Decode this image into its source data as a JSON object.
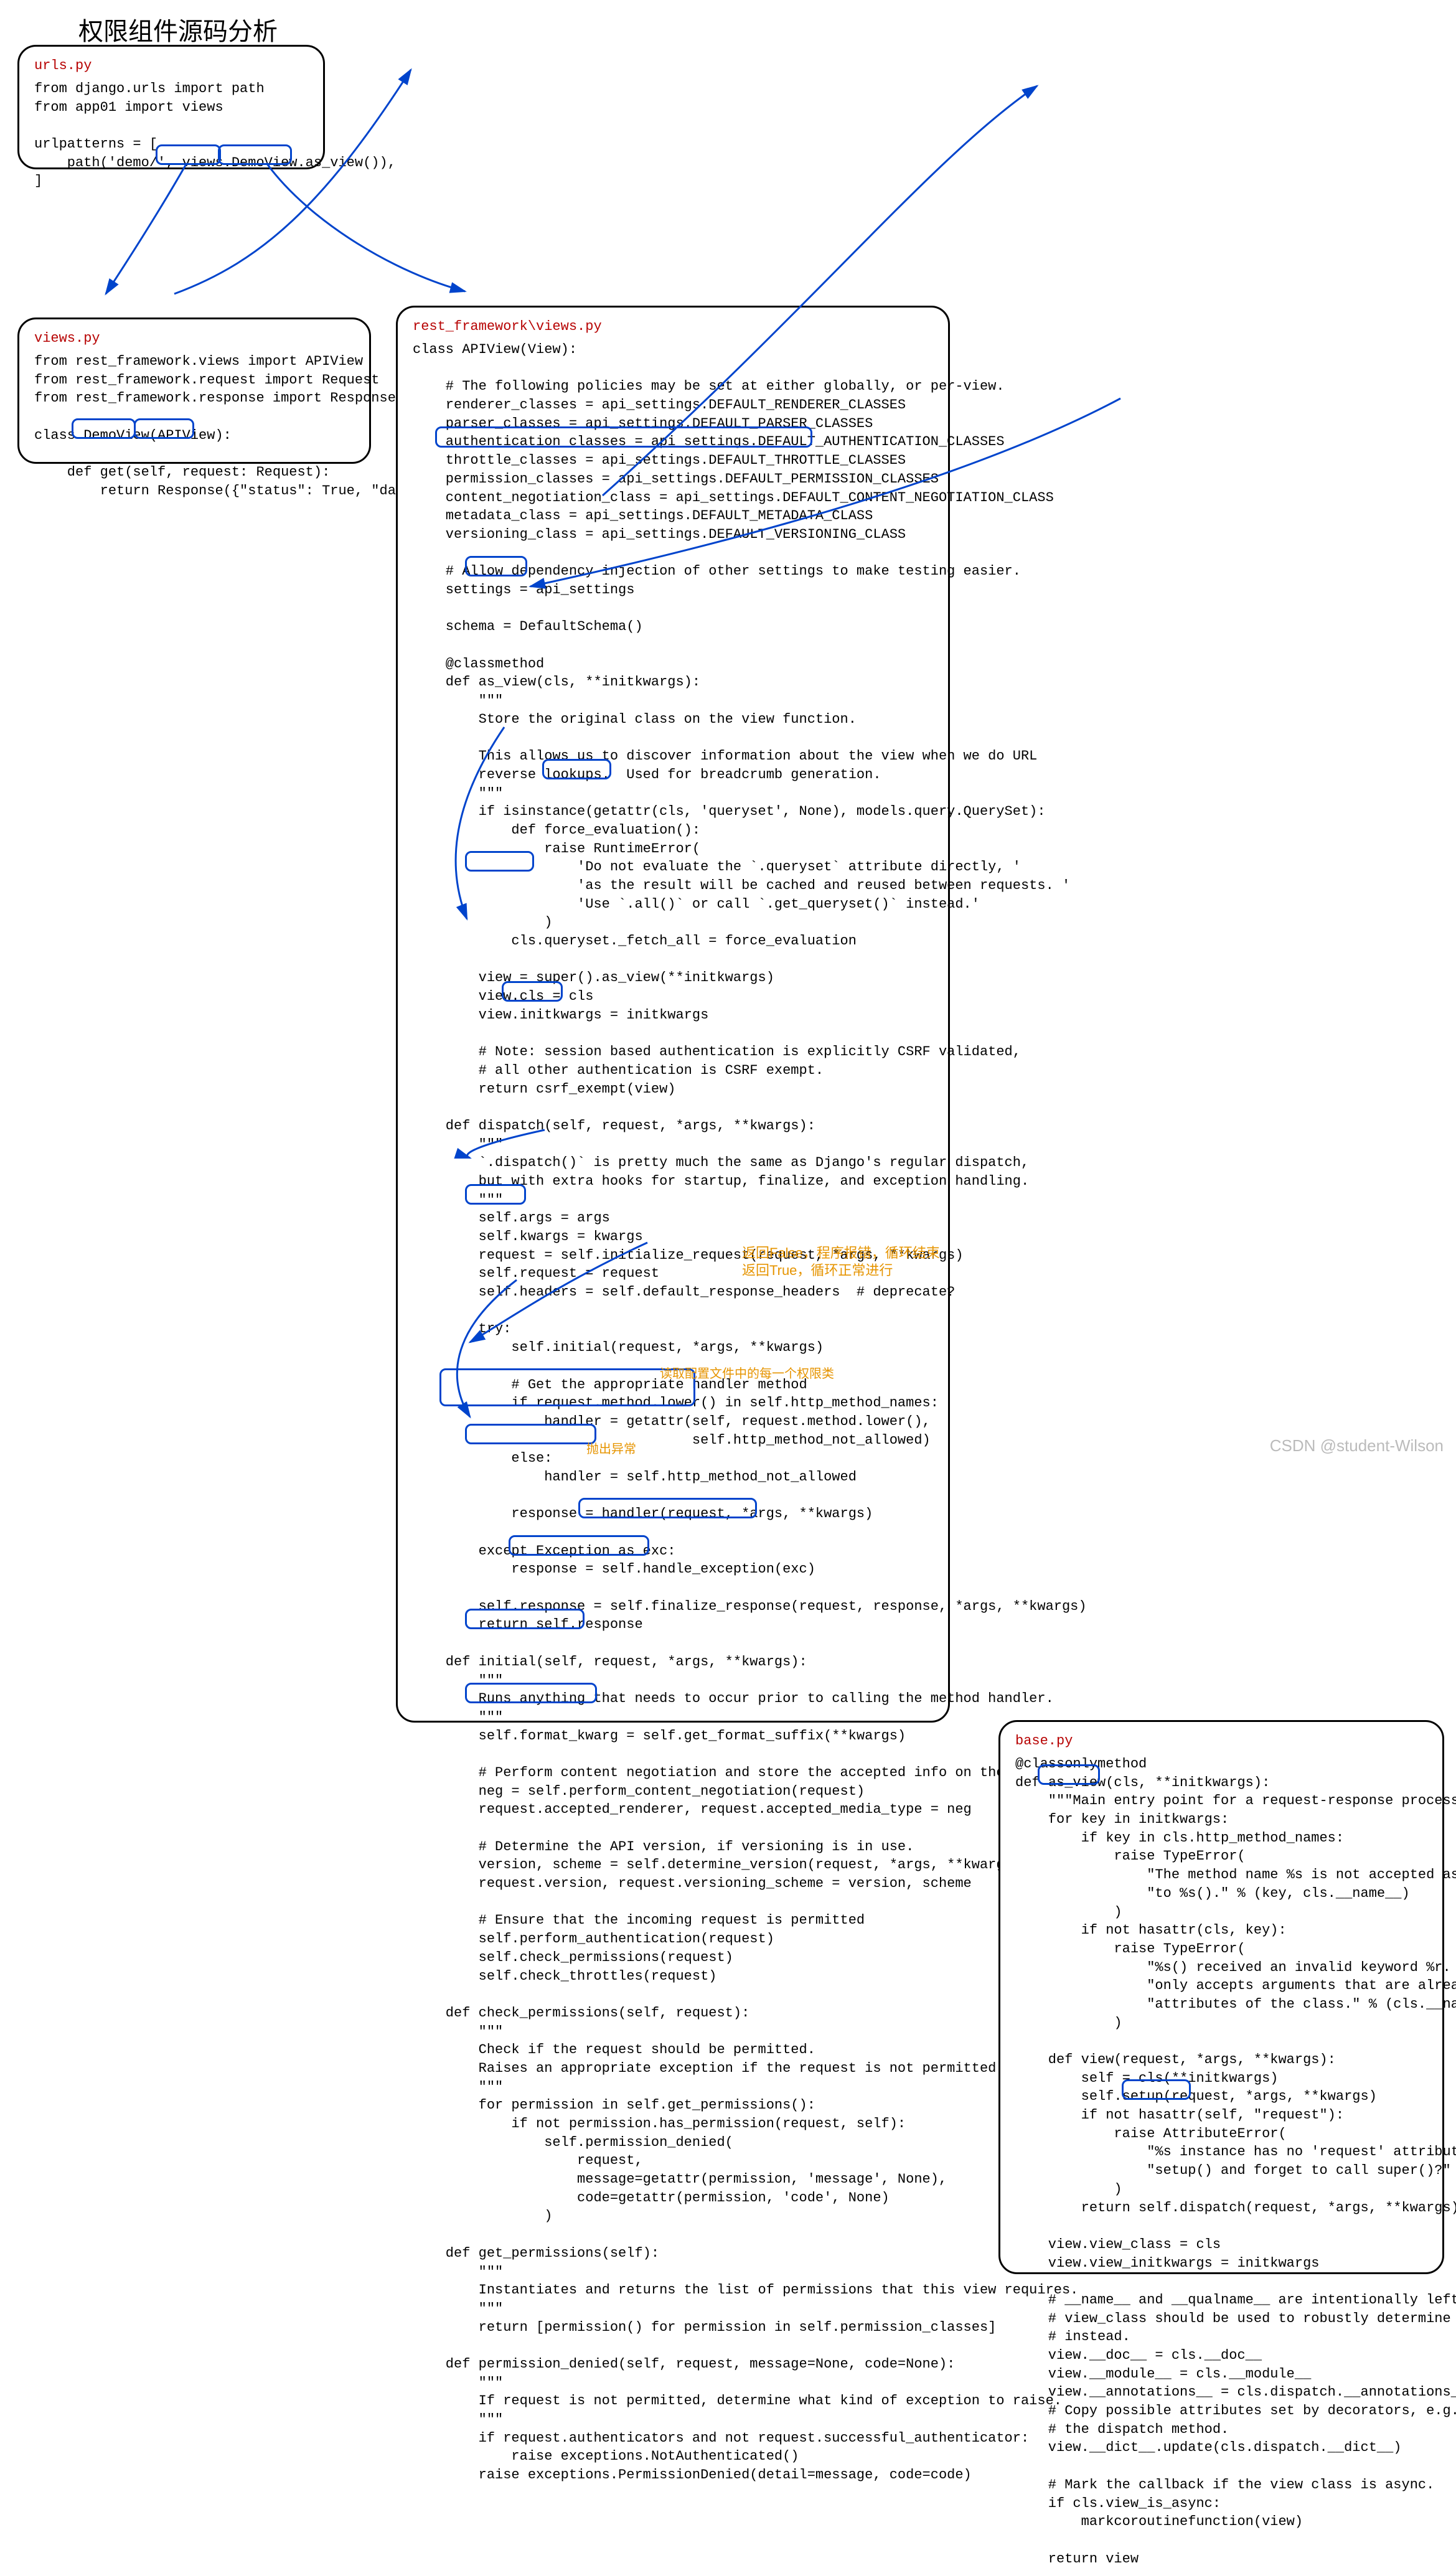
{
  "title": "权限组件源码分析",
  "watermark": "CSDN @student-Wilson",
  "notes": {
    "return_false": "返回False，程序报错，循环结束",
    "return_true": "返回True，循环正常进行",
    "throw": "抛出异常",
    "read_config": "读取配置文件中的每一个权限类"
  },
  "urls": {
    "file": "urls.py",
    "code": "from django.urls import path\nfrom app01 import views\n\nurlpatterns = [\n    path('demo/', views.DemoView.as_view()),\n]"
  },
  "views": {
    "file": "views.py",
    "code": "from rest_framework.views import APIView\nfrom rest_framework.request import Request\nfrom rest_framework.response import Response\n\nclass DemoView(APIView):\n\n    def get(self, request: Request):\n        return Response({\"status\": True, \"data\": \"OK\"})"
  },
  "rf_views": {
    "file": "rest_framework\\views.py",
    "code": "class APIView(View):\n\n    # The following policies may be set at either globally, or per-view.\n    renderer_classes = api_settings.DEFAULT_RENDERER_CLASSES\n    parser_classes = api_settings.DEFAULT_PARSER_CLASSES\n    authentication_classes = api_settings.DEFAULT_AUTHENTICATION_CLASSES\n    throttle_classes = api_settings.DEFAULT_THROTTLE_CLASSES\n    permission_classes = api_settings.DEFAULT_PERMISSION_CLASSES\n    content_negotiation_class = api_settings.DEFAULT_CONTENT_NEGOTIATION_CLASS\n    metadata_class = api_settings.DEFAULT_METADATA_CLASS\n    versioning_class = api_settings.DEFAULT_VERSIONING_CLASS\n\n    # Allow dependency injection of other settings to make testing easier.\n    settings = api_settings\n\n    schema = DefaultSchema()\n\n    @classmethod\n    def as_view(cls, **initkwargs):\n        \"\"\"\n        Store the original class on the view function.\n\n        This allows us to discover information about the view when we do URL\n        reverse lookups.  Used for breadcrumb generation.\n        \"\"\"\n        if isinstance(getattr(cls, 'queryset', None), models.query.QuerySet):\n            def force_evaluation():\n                raise RuntimeError(\n                    'Do not evaluate the `.queryset` attribute directly, '\n                    'as the result will be cached and reused between requests. '\n                    'Use `.all()` or call `.get_queryset()` instead.'\n                )\n            cls.queryset._fetch_all = force_evaluation\n\n        view = super().as_view(**initkwargs)\n        view.cls = cls\n        view.initkwargs = initkwargs\n\n        # Note: session based authentication is explicitly CSRF validated,\n        # all other authentication is CSRF exempt.\n        return csrf_exempt(view)\n\n    def dispatch(self, request, *args, **kwargs):\n        \"\"\"\n        `.dispatch()` is pretty much the same as Django's regular dispatch,\n        but with extra hooks for startup, finalize, and exception handling.\n        \"\"\"\n        self.args = args\n        self.kwargs = kwargs\n        request = self.initialize_request(request, *args, **kwargs)\n        self.request = request\n        self.headers = self.default_response_headers  # deprecate?\n\n        try:\n            self.initial(request, *args, **kwargs)\n\n            # Get the appropriate handler method\n            if request.method.lower() in self.http_method_names:\n                handler = getattr(self, request.method.lower(),\n                                  self.http_method_not_allowed)\n            else:\n                handler = self.http_method_not_allowed\n\n            response = handler(request, *args, **kwargs)\n\n        except Exception as exc:\n            response = self.handle_exception(exc)\n\n        self.response = self.finalize_response(request, response, *args, **kwargs)\n        return self.response\n\n    def initial(self, request, *args, **kwargs):\n        \"\"\"\n        Runs anything that needs to occur prior to calling the method handler.\n        \"\"\"\n        self.format_kwarg = self.get_format_suffix(**kwargs)\n\n        # Perform content negotiation and store the accepted info on the request\n        neg = self.perform_content_negotiation(request)\n        request.accepted_renderer, request.accepted_media_type = neg\n\n        # Determine the API version, if versioning is in use.\n        version, scheme = self.determine_version(request, *args, **kwargs)\n        request.version, request.versioning_scheme = version, scheme\n\n        # Ensure that the incoming request is permitted\n        self.perform_authentication(request)\n        self.check_permissions(request)\n        self.check_throttles(request)\n\n    def check_permissions(self, request):\n        \"\"\"\n        Check if the request should be permitted.\n        Raises an appropriate exception if the request is not permitted.\n        \"\"\"\n        for permission in self.get_permissions():\n            if not permission.has_permission(request, self):\n                self.permission_denied(\n                    request,\n                    message=getattr(permission, 'message', None),\n                    code=getattr(permission, 'code', None)\n                )\n\n    def get_permissions(self):\n        \"\"\"\n        Instantiates and returns the list of permissions that this view requires.\n        \"\"\"\n        return [permission() for permission in self.permission_classes]\n\n    def permission_denied(self, request, message=None, code=None):\n        \"\"\"\n        If request is not permitted, determine what kind of exception to raise.\n        \"\"\"\n        if request.authenticators and not request.successful_authenticator:\n            raise exceptions.NotAuthenticated()\n        raise exceptions.PermissionDenied(detail=message, code=code)"
  },
  "base": {
    "file": "base.py",
    "code": "@classonlymethod\ndef as_view(cls, **initkwargs):\n    \"\"\"Main entry point for a request-response process.\"\"\"\n    for key in initkwargs:\n        if key in cls.http_method_names:\n            raise TypeError(\n                \"The method name %s is not accepted as a keyword argument \"\n                \"to %s().\" % (key, cls.__name__)\n            )\n        if not hasattr(cls, key):\n            raise TypeError(\n                \"%s() received an invalid keyword %r. as_view \"\n                \"only accepts arguments that are already \"\n                \"attributes of the class.\" % (cls.__name__, key)\n            )\n\n    def view(request, *args, **kwargs):\n        self = cls(**initkwargs)\n        self.setup(request, *args, **kwargs)\n        if not hasattr(self, \"request\"):\n            raise AttributeError(\n                \"%s instance has no 'request' attribute. Did you override \"\n                \"setup() and forget to call super()?\" % cls.__name__\n            )\n        return self.dispatch(request, *args, **kwargs)\n\n    view.view_class = cls\n    view.view_initkwargs = initkwargs\n\n    # __name__ and __qualname__ are intentionally left unchanged as\n    # view_class should be used to robustly determine the name of the view\n    # instead.\n    view.__doc__ = cls.__doc__\n    view.__module__ = cls.__module__\n    view.__annotations__ = cls.dispatch.__annotations__\n    # Copy possible attributes set by decorators, e.g. @csrf_exempt, from\n    # the dispatch method.\n    view.__dict__.update(cls.dispatch.__dict__)\n\n    # Mark the callback if the view class is async.\n    if cls.view_is_async:\n        markcoroutinefunction(view)\n\n    return view"
  }
}
